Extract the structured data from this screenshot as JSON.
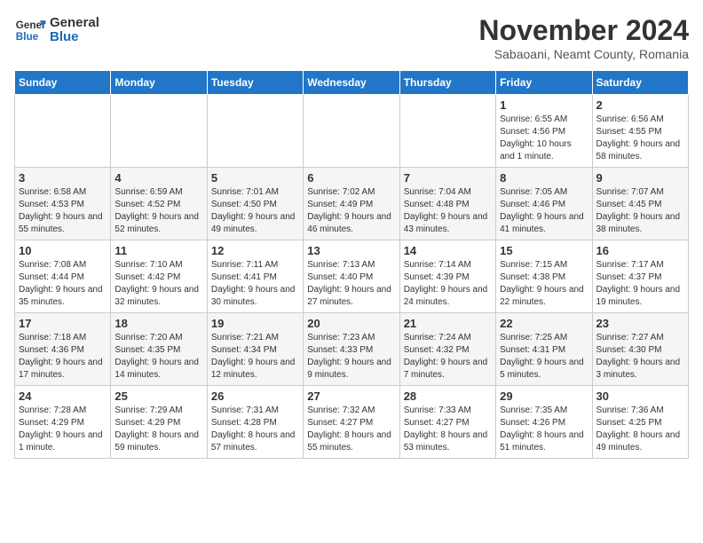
{
  "header": {
    "logo_line1": "General",
    "logo_line2": "Blue",
    "month": "November 2024",
    "location": "Sabaoani, Neamt County, Romania"
  },
  "weekdays": [
    "Sunday",
    "Monday",
    "Tuesday",
    "Wednesday",
    "Thursday",
    "Friday",
    "Saturday"
  ],
  "weeks": [
    [
      {
        "day": "",
        "info": ""
      },
      {
        "day": "",
        "info": ""
      },
      {
        "day": "",
        "info": ""
      },
      {
        "day": "",
        "info": ""
      },
      {
        "day": "",
        "info": ""
      },
      {
        "day": "1",
        "info": "Sunrise: 6:55 AM\nSunset: 4:56 PM\nDaylight: 10 hours and 1 minute."
      },
      {
        "day": "2",
        "info": "Sunrise: 6:56 AM\nSunset: 4:55 PM\nDaylight: 9 hours and 58 minutes."
      }
    ],
    [
      {
        "day": "3",
        "info": "Sunrise: 6:58 AM\nSunset: 4:53 PM\nDaylight: 9 hours and 55 minutes."
      },
      {
        "day": "4",
        "info": "Sunrise: 6:59 AM\nSunset: 4:52 PM\nDaylight: 9 hours and 52 minutes."
      },
      {
        "day": "5",
        "info": "Sunrise: 7:01 AM\nSunset: 4:50 PM\nDaylight: 9 hours and 49 minutes."
      },
      {
        "day": "6",
        "info": "Sunrise: 7:02 AM\nSunset: 4:49 PM\nDaylight: 9 hours and 46 minutes."
      },
      {
        "day": "7",
        "info": "Sunrise: 7:04 AM\nSunset: 4:48 PM\nDaylight: 9 hours and 43 minutes."
      },
      {
        "day": "8",
        "info": "Sunrise: 7:05 AM\nSunset: 4:46 PM\nDaylight: 9 hours and 41 minutes."
      },
      {
        "day": "9",
        "info": "Sunrise: 7:07 AM\nSunset: 4:45 PM\nDaylight: 9 hours and 38 minutes."
      }
    ],
    [
      {
        "day": "10",
        "info": "Sunrise: 7:08 AM\nSunset: 4:44 PM\nDaylight: 9 hours and 35 minutes."
      },
      {
        "day": "11",
        "info": "Sunrise: 7:10 AM\nSunset: 4:42 PM\nDaylight: 9 hours and 32 minutes."
      },
      {
        "day": "12",
        "info": "Sunrise: 7:11 AM\nSunset: 4:41 PM\nDaylight: 9 hours and 30 minutes."
      },
      {
        "day": "13",
        "info": "Sunrise: 7:13 AM\nSunset: 4:40 PM\nDaylight: 9 hours and 27 minutes."
      },
      {
        "day": "14",
        "info": "Sunrise: 7:14 AM\nSunset: 4:39 PM\nDaylight: 9 hours and 24 minutes."
      },
      {
        "day": "15",
        "info": "Sunrise: 7:15 AM\nSunset: 4:38 PM\nDaylight: 9 hours and 22 minutes."
      },
      {
        "day": "16",
        "info": "Sunrise: 7:17 AM\nSunset: 4:37 PM\nDaylight: 9 hours and 19 minutes."
      }
    ],
    [
      {
        "day": "17",
        "info": "Sunrise: 7:18 AM\nSunset: 4:36 PM\nDaylight: 9 hours and 17 minutes."
      },
      {
        "day": "18",
        "info": "Sunrise: 7:20 AM\nSunset: 4:35 PM\nDaylight: 9 hours and 14 minutes."
      },
      {
        "day": "19",
        "info": "Sunrise: 7:21 AM\nSunset: 4:34 PM\nDaylight: 9 hours and 12 minutes."
      },
      {
        "day": "20",
        "info": "Sunrise: 7:23 AM\nSunset: 4:33 PM\nDaylight: 9 hours and 9 minutes."
      },
      {
        "day": "21",
        "info": "Sunrise: 7:24 AM\nSunset: 4:32 PM\nDaylight: 9 hours and 7 minutes."
      },
      {
        "day": "22",
        "info": "Sunrise: 7:25 AM\nSunset: 4:31 PM\nDaylight: 9 hours and 5 minutes."
      },
      {
        "day": "23",
        "info": "Sunrise: 7:27 AM\nSunset: 4:30 PM\nDaylight: 9 hours and 3 minutes."
      }
    ],
    [
      {
        "day": "24",
        "info": "Sunrise: 7:28 AM\nSunset: 4:29 PM\nDaylight: 9 hours and 1 minute."
      },
      {
        "day": "25",
        "info": "Sunrise: 7:29 AM\nSunset: 4:29 PM\nDaylight: 8 hours and 59 minutes."
      },
      {
        "day": "26",
        "info": "Sunrise: 7:31 AM\nSunset: 4:28 PM\nDaylight: 8 hours and 57 minutes."
      },
      {
        "day": "27",
        "info": "Sunrise: 7:32 AM\nSunset: 4:27 PM\nDaylight: 8 hours and 55 minutes."
      },
      {
        "day": "28",
        "info": "Sunrise: 7:33 AM\nSunset: 4:27 PM\nDaylight: 8 hours and 53 minutes."
      },
      {
        "day": "29",
        "info": "Sunrise: 7:35 AM\nSunset: 4:26 PM\nDaylight: 8 hours and 51 minutes."
      },
      {
        "day": "30",
        "info": "Sunrise: 7:36 AM\nSunset: 4:25 PM\nDaylight: 8 hours and 49 minutes."
      }
    ]
  ]
}
